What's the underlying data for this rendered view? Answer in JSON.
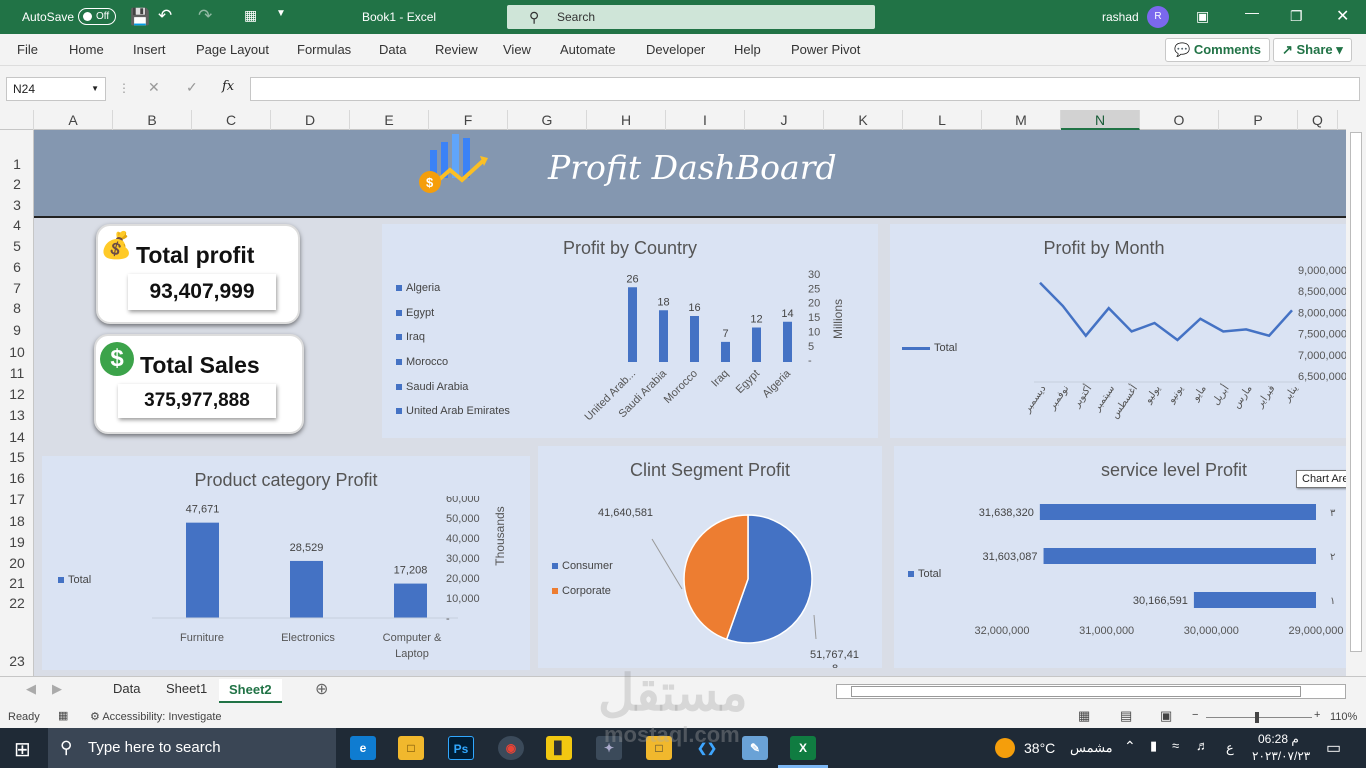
{
  "titlebar": {
    "autosave_label": "AutoSave",
    "autosave_state": "Off",
    "doc_title": "Book1 - Excel",
    "search_placeholder": "Search",
    "user_name": "rashad",
    "user_initial": "R"
  },
  "menu": [
    "File",
    "Home",
    "Insert",
    "Page Layout",
    "Formulas",
    "Data",
    "Review",
    "View",
    "Automate",
    "Developer",
    "Help",
    "Power Pivot"
  ],
  "ribbon_buttons": {
    "comments": "Comments",
    "share": "Share"
  },
  "formula_bar": {
    "name_box": "N24",
    "fx": "fx",
    "value": ""
  },
  "columns": [
    "A",
    "B",
    "C",
    "D",
    "E",
    "F",
    "G",
    "H",
    "I",
    "J",
    "K",
    "L",
    "M",
    "N",
    "O",
    "P",
    "Q"
  ],
  "selected_column": "N",
  "rows": [
    "1",
    "2",
    "3",
    "4",
    "5",
    "6",
    "7",
    "8",
    "9",
    "10",
    "11",
    "12",
    "13",
    "14",
    "15",
    "16",
    "17",
    "18",
    "19",
    "20",
    "21",
    "22",
    "23"
  ],
  "dashboard": {
    "title": "Profit DashBoard",
    "kpi_profit": {
      "label": "Total profit",
      "value": "93,407,999"
    },
    "kpi_sales": {
      "label": "Total Sales",
      "value": "375,977,888"
    }
  },
  "chart_data": [
    {
      "type": "bar",
      "title": "Profit by Country",
      "legend": [
        "Algeria",
        "Egypt",
        "Iraq",
        "Morocco",
        "Saudi Arabia",
        "United Arab Emirates"
      ],
      "categories": [
        "United Arab...",
        "Saudi Arabia",
        "Morocco",
        "Iraq",
        "Egypt",
        "Algeria"
      ],
      "values": [
        26,
        18,
        16,
        7,
        12,
        14
      ],
      "ylabel": "Millions",
      "ylim": [
        0,
        30
      ],
      "yticks": [
        "30",
        "25",
        "20",
        "15",
        "10",
        "5",
        "-"
      ],
      "color": "#4472c4"
    },
    {
      "type": "line",
      "title": "Profit by Month",
      "series_name": "Total",
      "categories": [
        "ديسمبر",
        "نوفمبر",
        "أكتوبر",
        "سبتمبر",
        "أغسطس",
        "يوليو",
        "يونيو",
        "مايو",
        "أبريل",
        "مارس",
        "فبراير",
        "يناير"
      ],
      "values": [
        8700000,
        8150000,
        7450000,
        8100000,
        7550000,
        7750000,
        7350000,
        7850000,
        7550000,
        7600000,
        7450000,
        8050000
      ],
      "ylim": [
        6500000,
        9000000
      ],
      "yticks": [
        "9,000,000",
        "8,500,000",
        "8,000,000",
        "7,500,000",
        "7,000,000",
        "6,500,000"
      ],
      "color": "#4472c4"
    },
    {
      "type": "bar",
      "title": "Product category Profit",
      "series_name": "Total",
      "categories": [
        "Furniture",
        "Electronics",
        "Computer & Laptop"
      ],
      "values": [
        47671,
        28529,
        17208
      ],
      "labels": [
        "47,671",
        "28,529",
        "17,208"
      ],
      "ylabel": "Thousands",
      "ylim": [
        0,
        60000
      ],
      "yticks": [
        "60,000",
        "50,000",
        "40,000",
        "30,000",
        "20,000",
        "10,000",
        "-"
      ],
      "color": "#4472c4"
    },
    {
      "type": "pie",
      "title": "Clint Segment Profit",
      "categories": [
        "Consumer",
        "Corporate"
      ],
      "values": [
        51767418,
        41640581
      ],
      "labels": [
        "51,767,418",
        "41,640,581"
      ],
      "colors": [
        "#4472c4",
        "#ed7d31"
      ]
    },
    {
      "type": "bar",
      "orientation": "horizontal",
      "title": "service level Profit",
      "series_name": "Total",
      "categories": [
        "٣",
        "٢",
        "١"
      ],
      "values": [
        31638320,
        31603087,
        30166591
      ],
      "labels": [
        "31,638,320",
        "31,603,087",
        "30,166,591"
      ],
      "xlim": [
        29000000,
        32000000
      ],
      "xticks": [
        "32,000,000",
        "31,000,000",
        "30,000,000",
        "29,000,000"
      ],
      "color": "#4472c4"
    }
  ],
  "tooltip": "Chart Area",
  "sheet_tabs": [
    "Data",
    "Sheet1",
    "Sheet2"
  ],
  "active_tab": "Sheet2",
  "status": {
    "ready": "Ready",
    "accessibility": "Accessibility: Investigate",
    "zoom": "110%"
  },
  "taskbar": {
    "search": "Type here to search",
    "weather": "38°C",
    "weather_label": "مشمس",
    "lang": "ع",
    "time": "06:28 م",
    "date": "٢٠٢٣/٠٧/٢٣"
  },
  "watermark": {
    "text": "مستقل",
    "url": "mostaql.com"
  }
}
